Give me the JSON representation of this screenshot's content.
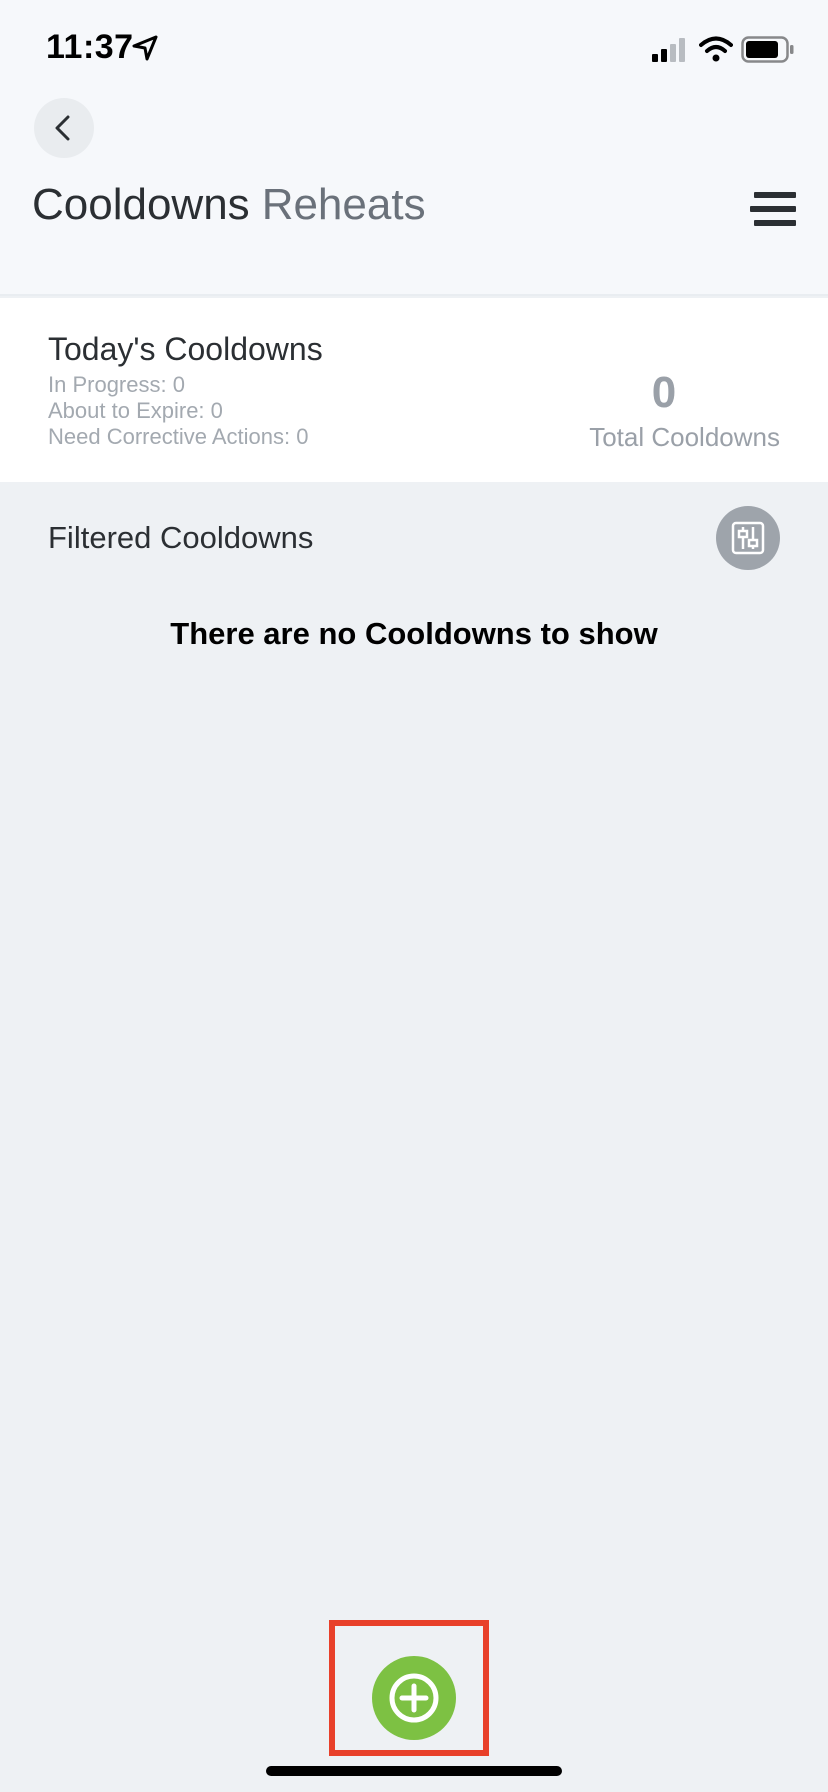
{
  "status_bar": {
    "time": "11:37"
  },
  "header": {
    "tabs": [
      {
        "label": "Cooldowns",
        "active": true
      },
      {
        "label": "Reheats",
        "active": false
      }
    ]
  },
  "summary": {
    "title": "Today's Cooldowns",
    "in_progress": "In Progress: 0",
    "about_to_expire": "About to Expire: 0",
    "need_corrective_actions": "Need Corrective Actions: 0",
    "total_count": "0",
    "total_label": "Total Cooldowns"
  },
  "filtered": {
    "title": "Filtered Cooldowns",
    "empty_message": "There are no Cooldowns to show"
  },
  "icons": {
    "back": "chevron-left-icon",
    "menu": "hamburger-menu-icon",
    "filter": "filter-sliders-icon",
    "add": "plus-circle-icon"
  },
  "colors": {
    "accent_green": "#7dc143",
    "highlight_red": "#e8402a",
    "muted_gray": "#9ea4ab"
  }
}
